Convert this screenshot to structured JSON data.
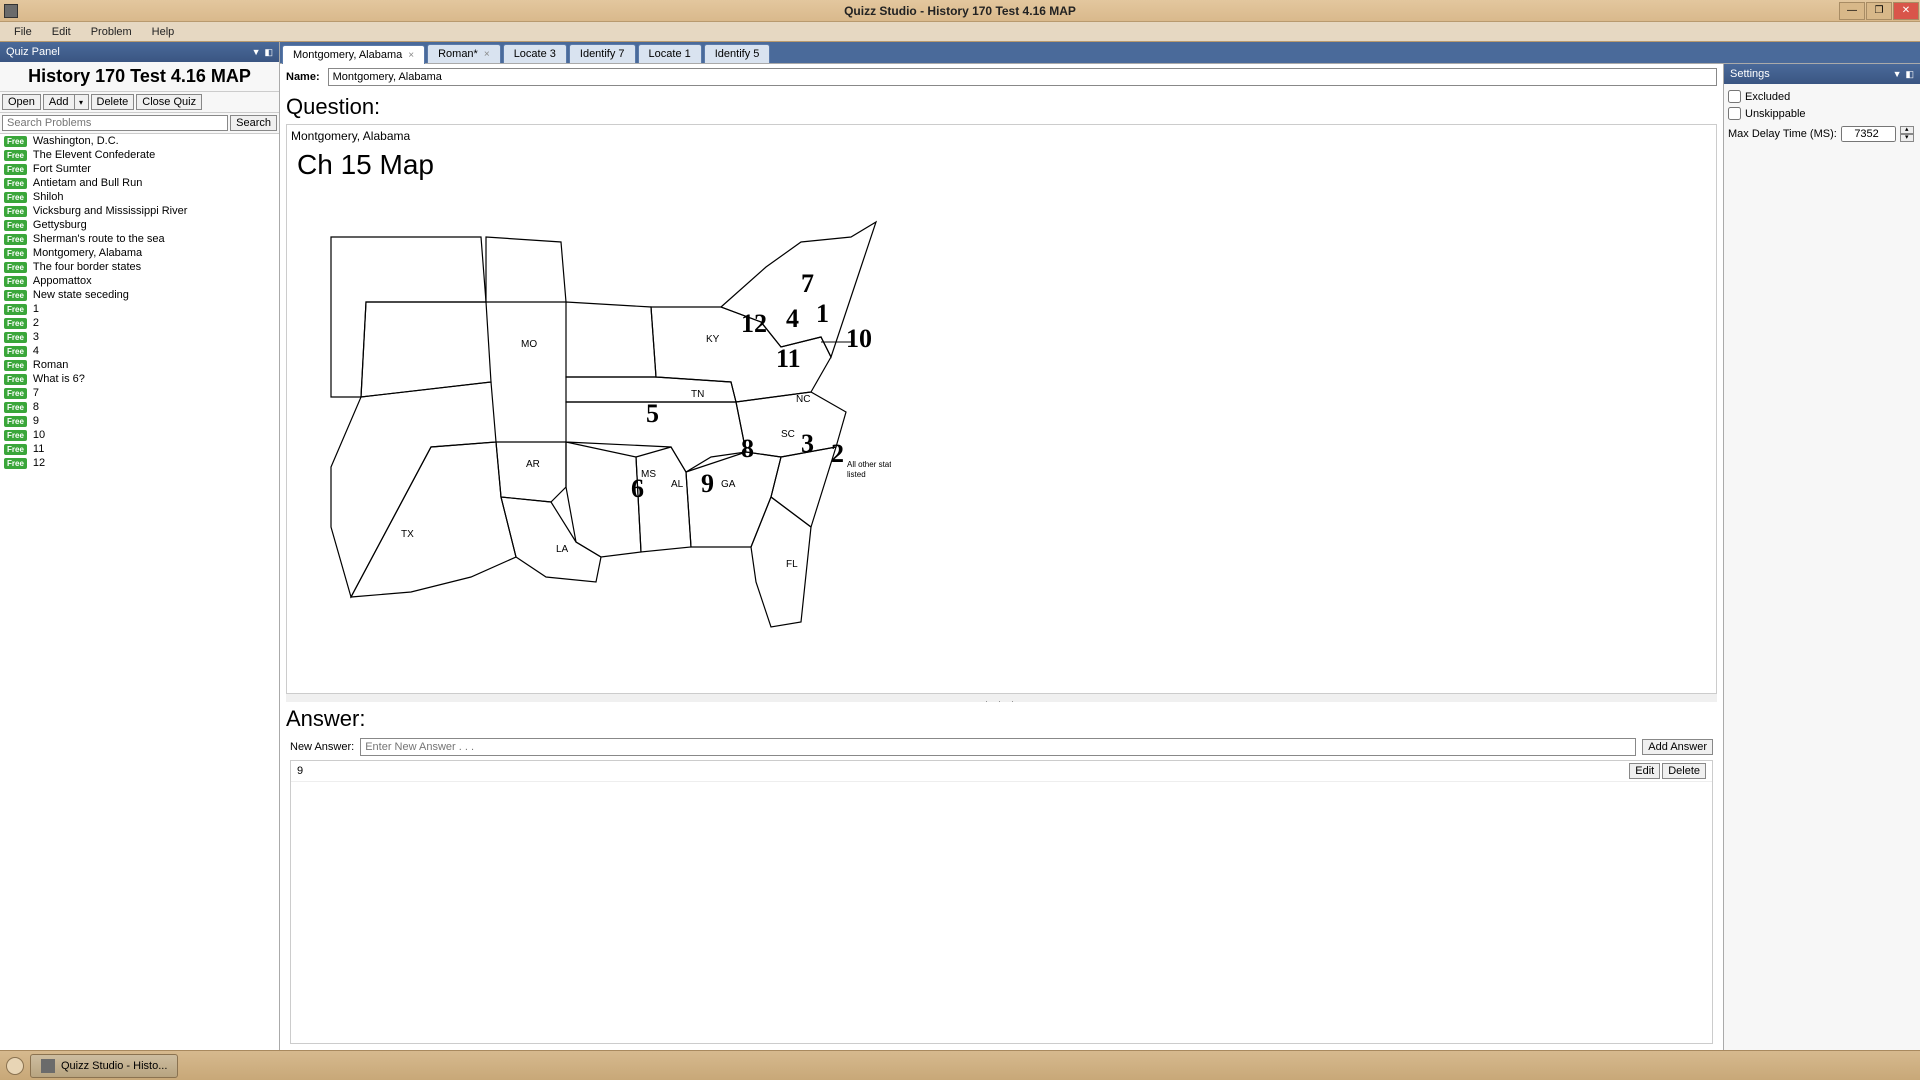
{
  "window": {
    "title": "Quizz Studio  - History 170 Test 4.16 MAP"
  },
  "menubar": [
    "File",
    "Edit",
    "Problem",
    "Help"
  ],
  "quiz_panel": {
    "title": "Quiz Panel",
    "quiz_name": "History 170 Test 4.16 MAP",
    "toolbar": {
      "open": "Open",
      "add": "Add",
      "delete": "Delete",
      "close_quiz": "Close Quiz"
    },
    "search_placeholder": "Search Problems",
    "search_button": "Search",
    "badge": "Free",
    "problems": [
      "Washington, D.C.",
      "The Elevent Confederate",
      "Fort Sumter",
      "Antietam and Bull Run",
      "Shiloh",
      "Vicksburg and Mississippi River",
      "Gettysburg",
      "Sherman's route to the sea",
      "Montgomery, Alabama",
      "The four border states",
      "Appomattox",
      "New state seceding",
      "1",
      "2",
      "3",
      "4",
      "Roman",
      "What is 6?",
      "7",
      "8",
      "9",
      "10",
      "11",
      "12"
    ]
  },
  "tabs": [
    {
      "label": "Montgomery, Alabama",
      "active": true,
      "closeable": true
    },
    {
      "label": "Roman*",
      "active": false,
      "closeable": true
    },
    {
      "label": "Locate 3",
      "active": false,
      "closeable": false
    },
    {
      "label": "Identify 7",
      "active": false,
      "closeable": false
    },
    {
      "label": "Locate 1",
      "active": false,
      "closeable": false
    },
    {
      "label": "Identify 5",
      "active": false,
      "closeable": false
    }
  ],
  "editor": {
    "name_label": "Name:",
    "name_value": "Montgomery, Alabama",
    "question_heading": "Question:",
    "question_text": "Montgomery, Alabama",
    "map_title": "Ch 15 Map",
    "map_state_labels": [
      "MO",
      "KY",
      "TN",
      "NC",
      "SC",
      "GA",
      "AL",
      "MS",
      "AR",
      "LA",
      "TX",
      "FL"
    ],
    "map_numbers": [
      "1",
      "2",
      "3",
      "4",
      "5",
      "6",
      "7",
      "8",
      "9",
      "10",
      "11",
      "12"
    ],
    "map_annotation": "All other states listed",
    "answer_heading": "Answer:",
    "new_answer_label": "New Answer:",
    "new_answer_placeholder": "Enter New Answer . . .",
    "add_answer": "Add Answer",
    "answers": [
      {
        "value": "9",
        "edit": "Edit",
        "delete": "Delete"
      }
    ]
  },
  "settings": {
    "title": "Settings",
    "excluded": "Excluded",
    "unskippable": "Unskippable",
    "max_delay_label": "Max Delay Time (MS):",
    "max_delay_value": "7352"
  },
  "taskbar": {
    "button": "Quizz Studio  - Histo..."
  }
}
